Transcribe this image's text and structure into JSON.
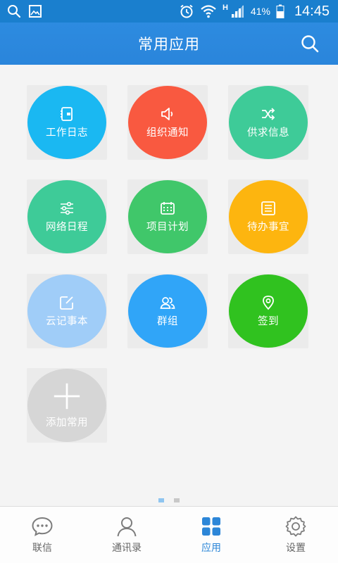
{
  "status_bar": {
    "network_type": "H",
    "battery": "41%",
    "time": "14:45"
  },
  "header": {
    "title": "常用应用"
  },
  "apps": [
    {
      "label": "工作日志",
      "icon": "notebook-icon",
      "color": "#1ab8f2"
    },
    {
      "label": "组织通知",
      "icon": "speaker-icon",
      "color": "#f95940"
    },
    {
      "label": "供求信息",
      "icon": "shuffle-icon",
      "color": "#3ecb98"
    },
    {
      "label": "网络日程",
      "icon": "sliders-icon",
      "color": "#3ecb98"
    },
    {
      "label": "项目计划",
      "icon": "calendar-icon",
      "color": "#40c76a"
    },
    {
      "label": "待办事宜",
      "icon": "list-icon",
      "color": "#fdb50f"
    },
    {
      "label": "云记事本",
      "icon": "edit-icon",
      "color": "#a0cdf8"
    },
    {
      "label": "群组",
      "icon": "group-icon",
      "color": "#30a5f8"
    },
    {
      "label": "签到",
      "icon": "location-icon",
      "color": "#30c21f"
    },
    {
      "label": "添加常用",
      "icon": "plus-icon",
      "color": "#d6d6d6"
    }
  ],
  "pagination": {
    "pages": 2,
    "current": 1
  },
  "tabs": [
    {
      "label": "联信",
      "icon": "chat-icon",
      "active": false
    },
    {
      "label": "通讯录",
      "icon": "contact-icon",
      "active": false
    },
    {
      "label": "应用",
      "icon": "apps-grid-icon",
      "active": true
    },
    {
      "label": "设置",
      "icon": "gear-icon",
      "active": false
    }
  ]
}
